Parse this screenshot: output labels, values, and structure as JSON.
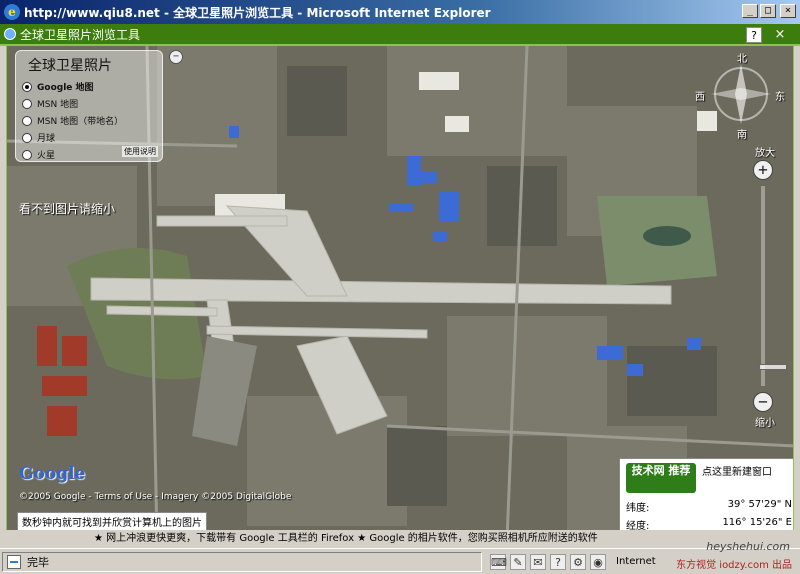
{
  "window": {
    "title": "http://www.qiu8.net - 全球卫星照片浏览工具 - Microsoft Internet Explorer",
    "buttons": [
      "_",
      "□",
      "×"
    ]
  },
  "app": {
    "title": "全球卫星照片浏览工具",
    "help_label": "?",
    "close_label": "×"
  },
  "panel": {
    "title": "全球卫星照片",
    "options": [
      {
        "label": "Google 地图",
        "selected": true
      },
      {
        "label": "MSN 地图",
        "selected": false
      },
      {
        "label": "MSN 地图（带地名）",
        "selected": false
      },
      {
        "label": "月球",
        "selected": false
      },
      {
        "label": "火星",
        "selected": false
      }
    ],
    "help_label": "使用说明",
    "close_label": "−"
  },
  "hint": "看不到图片请缩小",
  "compass": {
    "north": "北",
    "east": "东",
    "south": "南",
    "west": "西"
  },
  "zoom": {
    "in_label": "放大",
    "out_label": "缩小",
    "in_symbol": "+",
    "out_symbol": "−",
    "level": 0.92
  },
  "map": {
    "google_logo": "Google",
    "copyright": "©2005 Google - Terms of Use - Imagery ©2005 DigitalGlobe",
    "tip": "数秒钟内就可找到并欣赏计算机上的图片"
  },
  "info": {
    "logo_text": "技术网 推荐",
    "link": "点这里新建窗口",
    "lat_label": "纬度:",
    "lat_value": "39° 57'29\" N",
    "lon_label": "经度:",
    "lon_value": "116° 15'26\" E"
  },
  "ticker": "★ 网上冲浪更快更爽，下载带有 Google 工具栏的 Firefox ★ Google 的相片软件，您购买照相机所应附送的软件",
  "status": {
    "text": "完毕",
    "zone": "Internet",
    "watermark": "东方视觉 iodzy.com 出品",
    "site": "heyshehui.com"
  },
  "colors": {
    "titlebar": "#0a246a",
    "appbar": "#3c7d0e",
    "runway": "#cfcfc8"
  }
}
